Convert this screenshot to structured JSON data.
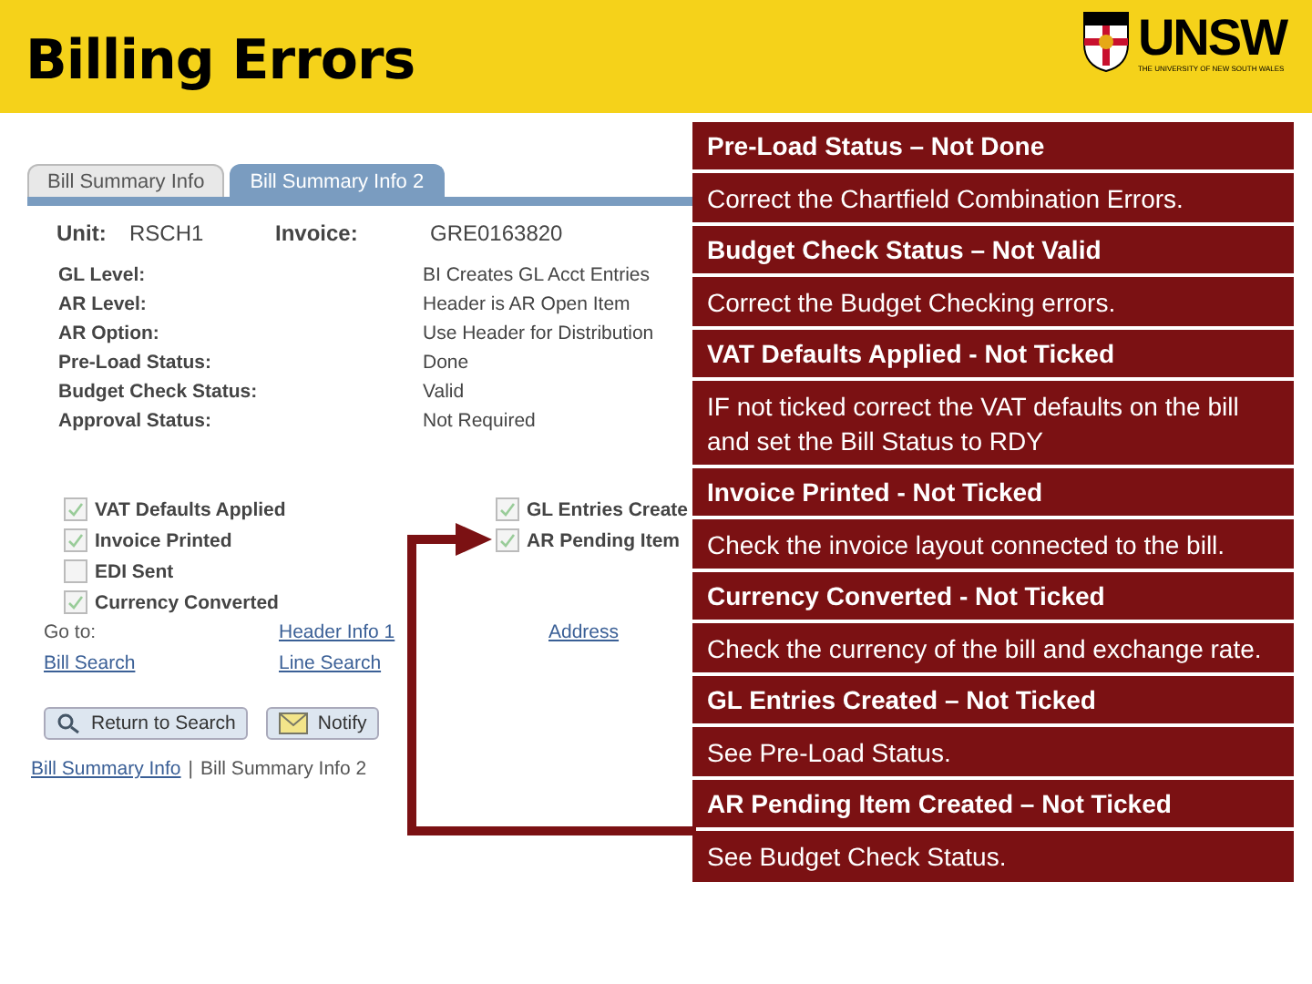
{
  "header": {
    "title": "Billing Errors",
    "logo": {
      "name": "UNSW",
      "tagline": "THE UNIVERSITY OF NEW SOUTH WALES"
    }
  },
  "screen": {
    "tabs": [
      {
        "label": "Bill Summary Info",
        "selected": false
      },
      {
        "label": "Bill Summary Info 2",
        "selected": true
      }
    ],
    "key_fields": [
      {
        "label": "Unit:",
        "value": "RSCH1"
      },
      {
        "label": "Invoice:",
        "value": "GRE0163820"
      }
    ],
    "fields": [
      {
        "label": "GL Level:",
        "value": "BI Creates GL Acct Entries"
      },
      {
        "label": "AR Level:",
        "value": "Header is AR Open Item"
      },
      {
        "label": "AR Option:",
        "value": "Use Header for Distribution"
      },
      {
        "label": "Pre-Load Status:",
        "value": "Done"
      },
      {
        "label": "Budget Check Status:",
        "value": "Valid"
      },
      {
        "label": "Approval Status:",
        "value": "Not Required"
      }
    ],
    "checks_left": [
      {
        "label": "VAT Defaults Applied",
        "checked": true
      },
      {
        "label": "Invoice Printed",
        "checked": true
      },
      {
        "label": "EDI Sent",
        "checked": false
      },
      {
        "label": "Currency Converted",
        "checked": true
      }
    ],
    "checks_right": [
      {
        "label": "GL Entries Create",
        "checked": true
      },
      {
        "label": "AR Pending Item",
        "checked": true
      }
    ],
    "goto_label": "Go to:",
    "goto_links": [
      "Header Info 1",
      "Address",
      "Bill Search",
      "Line Search"
    ],
    "buttons": [
      {
        "label": "Return to Search",
        "kind": "search"
      },
      {
        "label": "Notify",
        "kind": "notify"
      }
    ],
    "footer": {
      "links": [
        {
          "label": "Bill Summary Info",
          "current": false
        },
        {
          "label": "Bill Summary Info 2",
          "current": true
        }
      ],
      "separator": "|"
    }
  },
  "callouts": [
    {
      "title": "Pre-Load Status – Not Done",
      "body": "Correct the Chartfield Combination Errors."
    },
    {
      "title": "Budget Check Status – Not Valid",
      "body": "Correct the Budget Checking errors."
    },
    {
      "title": "VAT Defaults Applied - Not Ticked",
      "body": "IF not ticked correct the VAT defaults on the bill and set the Bill Status to RDY"
    },
    {
      "title": "Invoice Printed - Not Ticked",
      "body": "Check the invoice layout connected to the bill."
    },
    {
      "title": "Currency Converted - Not Ticked",
      "body": "Check the currency of the bill and exchange rate."
    },
    {
      "title": "GL Entries Created – Not Ticked",
      "body": "See Pre-Load Status."
    },
    {
      "title": "AR Pending Item Created – Not Ticked",
      "body": "See Budget Check Status."
    }
  ]
}
